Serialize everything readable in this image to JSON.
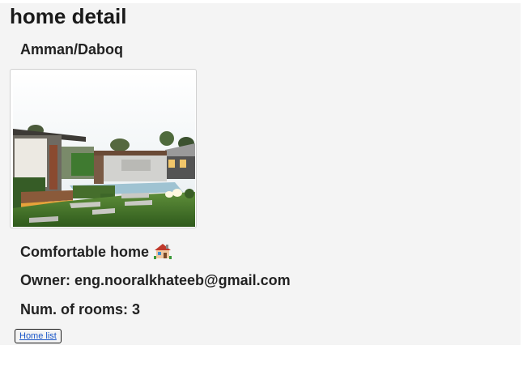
{
  "page": {
    "title": "home detail",
    "location": "Amman/Daboq"
  },
  "home": {
    "description": "Comfortable home",
    "description_icon": "house-with-garden-icon",
    "owner": "Owner: eng.nooralkhateeb@gmail.com",
    "rooms": "Num. of rooms: 3",
    "photo_icon": "house-photo"
  },
  "nav": {
    "home_list_label": "Home list"
  },
  "colors": {
    "link": "#1a56c8",
    "panel_background": "#f4f4f4"
  }
}
